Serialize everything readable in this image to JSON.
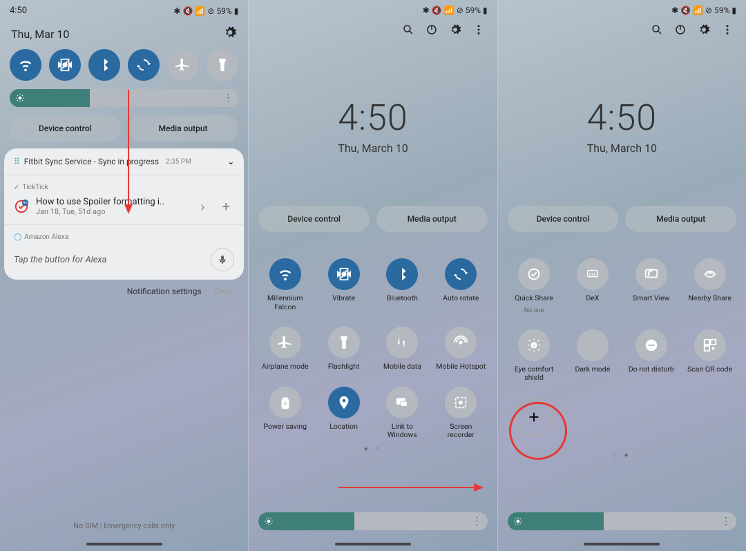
{
  "status": {
    "time": "4:50",
    "battery": "59%",
    "icons": [
      "bluetooth",
      "mute",
      "wifi",
      "dnd"
    ]
  },
  "p1": {
    "date": "Thu, Mar 10",
    "toggles": [
      {
        "name": "wifi",
        "on": true
      },
      {
        "name": "vibrate",
        "on": true
      },
      {
        "name": "bluetooth",
        "on": true
      },
      {
        "name": "autorotate",
        "on": true
      },
      {
        "name": "airplane",
        "on": false
      },
      {
        "name": "flashlight",
        "on": false
      }
    ],
    "brightness_pct": 35,
    "device_control": "Device control",
    "media_output": "Media output",
    "fitbit": {
      "title": "Fitbit Sync Service - Sync in progress",
      "time": "2:35 PM"
    },
    "ticktick": {
      "app": "TickTick",
      "title": "How to use Spoiler formatting i..",
      "sub": "Jan 18, Tue, 51d ago"
    },
    "alexa": {
      "app": "Amazon Alexa",
      "prompt": "Tap the button for Alexa"
    },
    "notif_settings": "Notification settings",
    "clear": "Clear",
    "nosim": "No SIM | Emergency calls only"
  },
  "p2": {
    "big_time": "4:50",
    "big_date": "Thu, March 10",
    "device_control": "Device control",
    "media_output": "Media output",
    "tiles": [
      {
        "name": "wifi",
        "label": "Millennium Falcon",
        "on": true
      },
      {
        "name": "vibrate",
        "label": "Vibrate",
        "on": true
      },
      {
        "name": "bluetooth",
        "label": "Bluetooth",
        "on": true
      },
      {
        "name": "autorotate",
        "label": "Auto rotate",
        "on": true
      },
      {
        "name": "airplane",
        "label": "Airplane mode",
        "on": false
      },
      {
        "name": "flashlight",
        "label": "Flashlight",
        "on": false
      },
      {
        "name": "mobiledata",
        "label": "Mobile data",
        "on": false
      },
      {
        "name": "hotspot",
        "label": "Mobile Hotspot",
        "on": false
      },
      {
        "name": "powersave",
        "label": "Power saving",
        "on": false
      },
      {
        "name": "location",
        "label": "Location",
        "on": true
      },
      {
        "name": "linkwin",
        "label": "Link to Windows",
        "on": false
      },
      {
        "name": "screenrec",
        "label": "Screen recorder",
        "on": false
      }
    ],
    "brightness_pct": 42
  },
  "p3": {
    "big_time": "4:50",
    "big_date": "Thu, March 10",
    "device_control": "Device control",
    "media_output": "Media output",
    "tiles": [
      {
        "name": "quickshare",
        "label": "Quick Share",
        "sub": "No one",
        "on": false
      },
      {
        "name": "dex",
        "label": "DeX",
        "on": false
      },
      {
        "name": "smartview",
        "label": "Smart View",
        "on": false
      },
      {
        "name": "nearbyshare",
        "label": "Nearby Share",
        "on": false
      },
      {
        "name": "eyecomfort",
        "label": "Eye comfort shield",
        "on": false
      },
      {
        "name": "darkmode",
        "label": "Dark mode",
        "on": false
      },
      {
        "name": "dnd",
        "label": "Do not disturb",
        "on": false
      },
      {
        "name": "qrcode",
        "label": "Scan QR code",
        "on": false
      }
    ],
    "brightness_pct": 42
  }
}
